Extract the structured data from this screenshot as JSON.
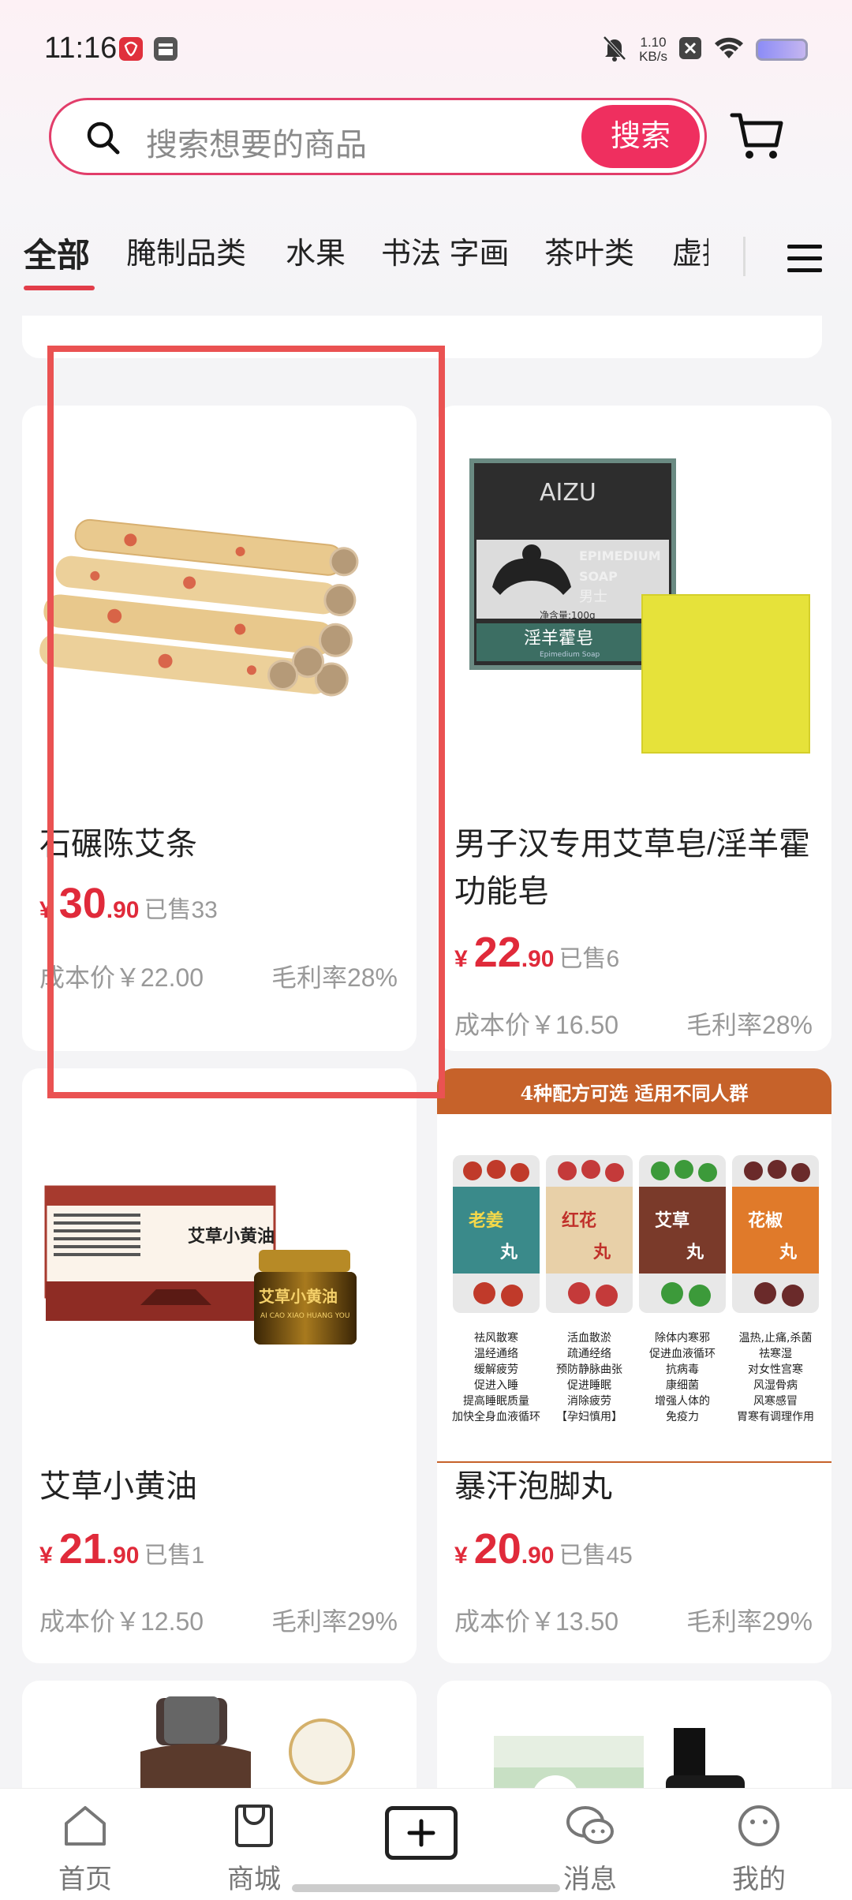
{
  "status_bar": {
    "time": "11:16",
    "net_speed_value": "1.10",
    "net_speed_unit": "KB/s"
  },
  "search": {
    "placeholder": "搜索想要的商品",
    "button_label": "搜索"
  },
  "tabs": [
    {
      "label": "全部",
      "active": true
    },
    {
      "label": "腌制品类",
      "active": false
    },
    {
      "label": "水果",
      "active": false
    },
    {
      "label": "书法 字画",
      "active": false
    },
    {
      "label": "茶叶类",
      "active": false
    },
    {
      "label": "虚拟",
      "active": false
    }
  ],
  "products": [
    {
      "title": "石碾陈艾条",
      "price_symbol": "¥",
      "price_int": "30",
      "price_dec": ".90",
      "sold": "已售33",
      "cost": "成本价￥22.00",
      "margin": "毛利率28%"
    },
    {
      "title": "男子汉专用艾草皂/淫羊霍功能皂",
      "price_symbol": "¥",
      "price_int": "22",
      "price_dec": ".90",
      "sold": "已售6",
      "cost": "成本价￥16.50",
      "margin": "毛利率28%",
      "image_text": {
        "brand": "AIZU",
        "line1": "EPIMEDIUM",
        "line2": "SOAP",
        "line3": "男士",
        "net": "净含量:100g",
        "cn_name": "淫羊藿皂",
        "en_sub": "Epimedium Soap"
      }
    },
    {
      "title": "艾草小黄油",
      "price_symbol": "¥",
      "price_int": "21",
      "price_dec": ".90",
      "sold": "已售1",
      "cost": "成本价￥12.50",
      "margin": "毛利率29%",
      "image_text": {
        "box_name": "艾草小黄油",
        "jar_name": "艾草小黄油",
        "jar_sub": "AI CAO XIAO HUANG YOU"
      }
    },
    {
      "title": "暴汗泡脚丸",
      "price_symbol": "¥",
      "price_int": "20",
      "price_dec": ".90",
      "sold": "已售45",
      "cost": "成本价￥13.50",
      "margin": "毛利率29%",
      "image_text": {
        "banner": "4种配方可选 适用不同人群",
        "jars": [
          "老姜",
          "红花",
          "艾草",
          "花椒"
        ],
        "jar_suffix": "丸",
        "cols": [
          [
            "祛风散寒",
            "温经通络",
            "缓解疲劳",
            "促进入睡",
            "提高睡眠质量",
            "加快全身血液循环"
          ],
          [
            "活血散淤",
            "疏通经络",
            "预防静脉曲张",
            "促进睡眠",
            "消除疲劳",
            "【孕妇慎用】"
          ],
          [
            "除体内寒邪",
            "促进血液循环",
            "抗病毒",
            "康细菌",
            "增强人体的",
            "免疫力"
          ],
          [
            "温热,止痛,杀菌",
            "祛寒湿",
            "对女性宫寒",
            "风湿骨病",
            "风寒感冒",
            "胃寒有调理作用"
          ]
        ]
      }
    }
  ],
  "bottom_nav": [
    {
      "label": "首页"
    },
    {
      "label": "商城"
    },
    {
      "label": ""
    },
    {
      "label": "消息"
    },
    {
      "label": "我的"
    }
  ],
  "colors": {
    "accent": "#ef2f5f",
    "price": "#e02a3a",
    "highlight": "#ea5252"
  }
}
